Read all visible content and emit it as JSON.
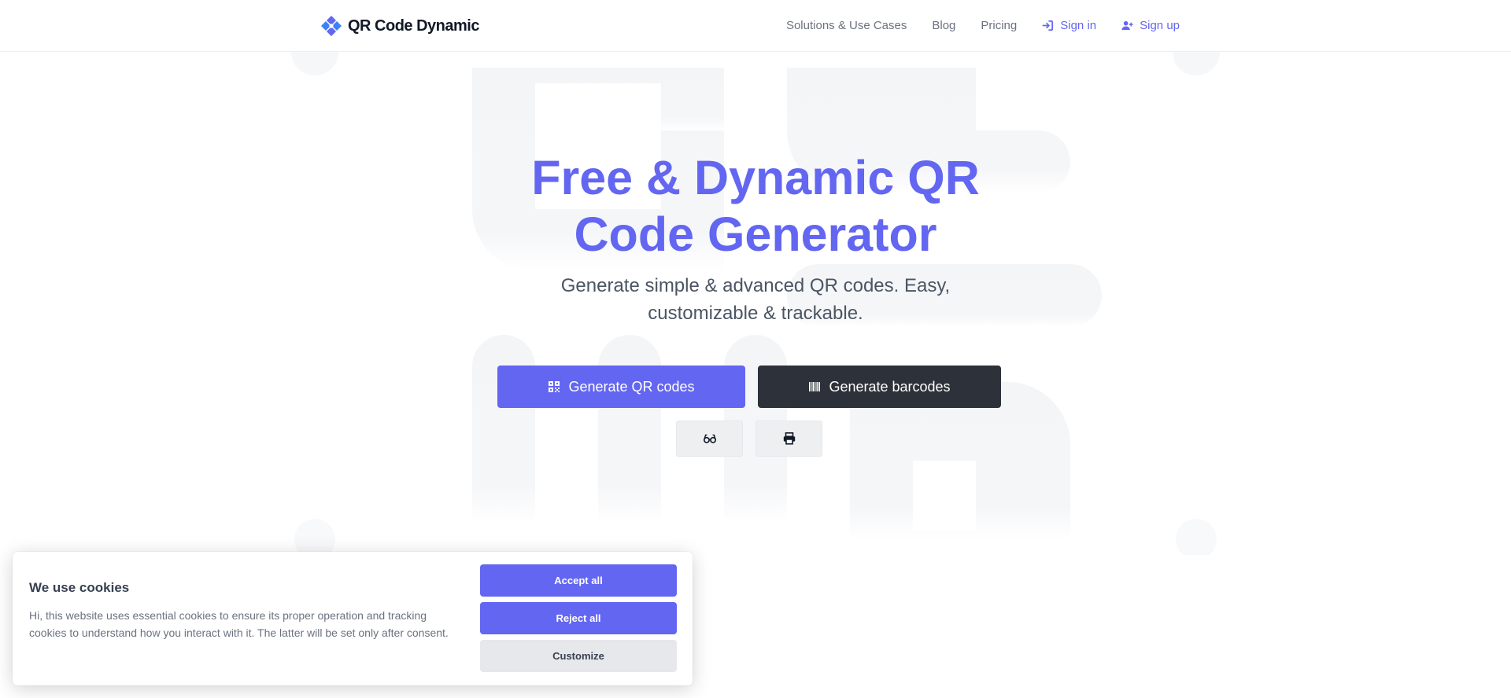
{
  "header": {
    "logo_text": "QR Code Dynamic",
    "nav": [
      {
        "label": "Solutions & Use Cases"
      },
      {
        "label": "Blog"
      },
      {
        "label": "Pricing"
      },
      {
        "label": "Sign in",
        "icon": "sign-in-icon"
      },
      {
        "label": "Sign up",
        "icon": "user-plus-icon"
      }
    ]
  },
  "hero": {
    "title": "Free & Dynamic QR Code Generator",
    "subtitle": "Generate simple & advanced QR codes. Easy, customizable & trackable.",
    "cta_qr": "Generate QR codes",
    "cta_barcode": "Generate barcodes",
    "mini_icons": [
      "glasses-icon",
      "printer-icon"
    ]
  },
  "cookie": {
    "title": "We use cookies ",
    "text": "Hi, this website uses essential cookies to ensure its proper operation and tracking cookies to understand how you interact with it. The latter will be set only after consent.",
    "accept": "Accept all",
    "reject": "Reject all",
    "customize": "Customize"
  },
  "colors": {
    "accent": "#6366f1",
    "dark_button": "#2d3139",
    "pattern": "#f4f5f7"
  }
}
